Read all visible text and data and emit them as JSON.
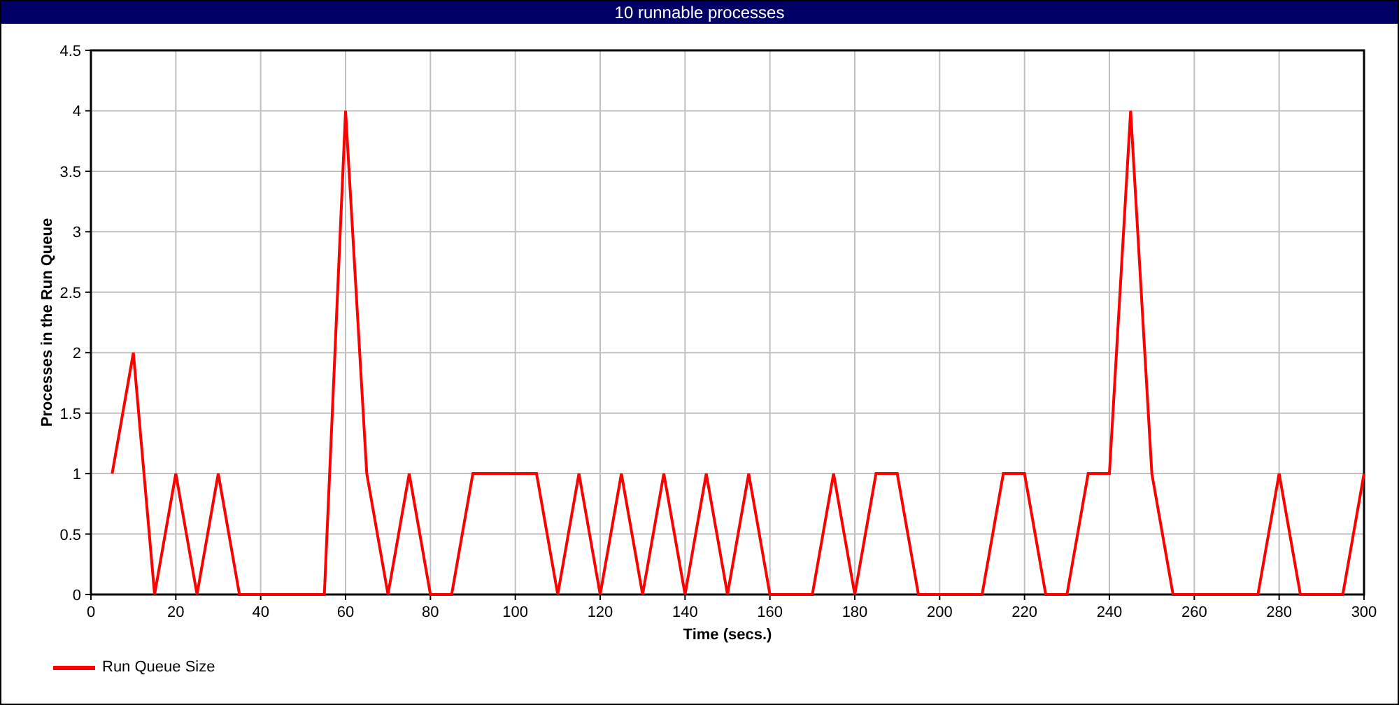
{
  "window": {
    "title": "10 runnable processes"
  },
  "chart": {
    "chart_data": {
      "type": "line",
      "xlabel": "Time (secs.)",
      "ylabel": "Processes in the Run Queue",
      "x": [
        5,
        10,
        15,
        20,
        25,
        30,
        35,
        40,
        45,
        50,
        55,
        60,
        65,
        70,
        75,
        80,
        85,
        90,
        95,
        100,
        105,
        110,
        115,
        120,
        125,
        130,
        135,
        140,
        145,
        150,
        155,
        160,
        165,
        170,
        175,
        180,
        185,
        190,
        195,
        200,
        205,
        210,
        215,
        220,
        225,
        230,
        235,
        240,
        245,
        250,
        255,
        260,
        265,
        270,
        275,
        280,
        285,
        290,
        295,
        300
      ],
      "series": [
        {
          "name": "Run Queue Size",
          "color": "#ff0000",
          "values": [
            1,
            2,
            0,
            1,
            0,
            1,
            0,
            0,
            0,
            0,
            0,
            4,
            1,
            0,
            1,
            0,
            0,
            1,
            1,
            1,
            1,
            0,
            1,
            0,
            1,
            0,
            1,
            0,
            1,
            0,
            1,
            0,
            0,
            0,
            1,
            0,
            1,
            1,
            0,
            0,
            0,
            0,
            1,
            1,
            0,
            0,
            1,
            1,
            4,
            1,
            0,
            0,
            0,
            0,
            0,
            1,
            0,
            0,
            0,
            1
          ]
        }
      ],
      "xlim": [
        0,
        300
      ],
      "ylim": [
        0,
        4.5
      ],
      "xticks": [
        0,
        20,
        40,
        60,
        80,
        100,
        120,
        140,
        160,
        180,
        200,
        220,
        240,
        260,
        280,
        300
      ],
      "yticks": [
        0,
        0.5,
        1,
        1.5,
        2,
        2.5,
        3,
        3.5,
        4,
        4.5
      ],
      "grid": true
    }
  }
}
